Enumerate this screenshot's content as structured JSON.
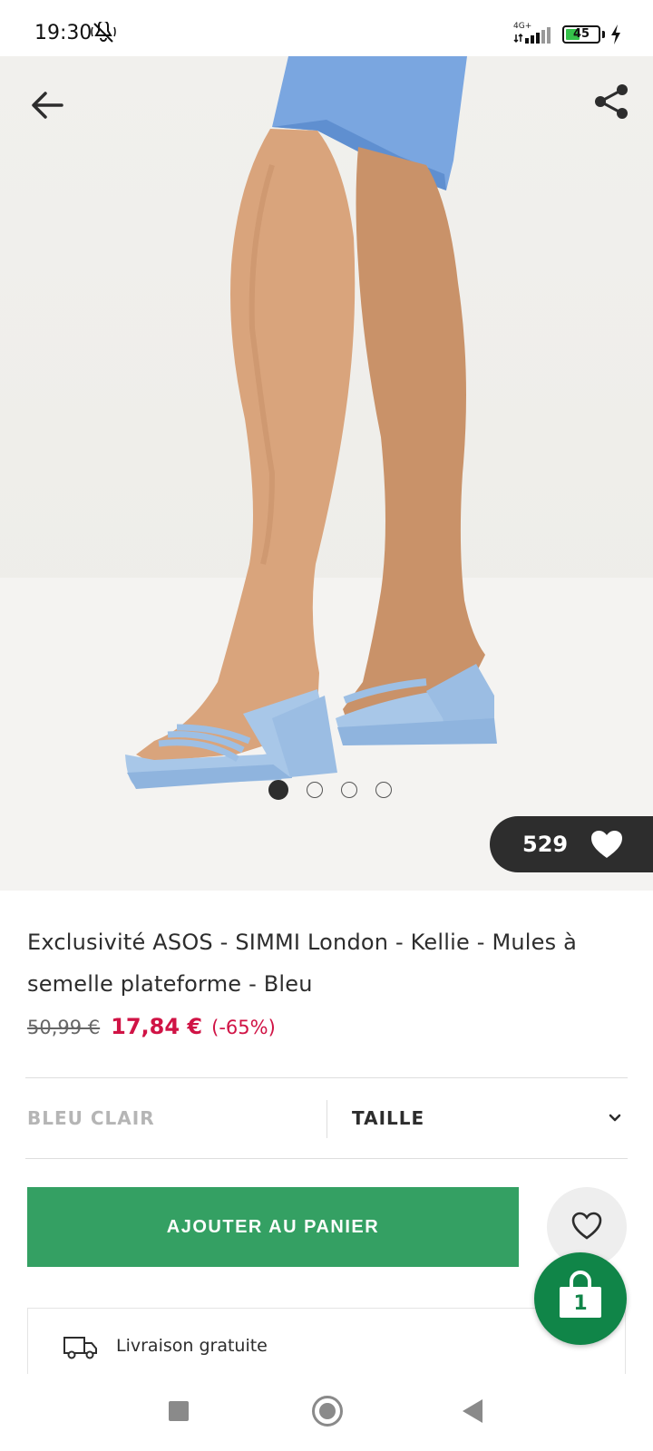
{
  "status_bar": {
    "time": "19:30",
    "network": "4G+",
    "battery": "45",
    "battery_level": 0.45
  },
  "icons": {
    "back": "arrow-left-icon",
    "share": "share-icon",
    "like": "heart-filled-icon",
    "save": "heart-outline-icon",
    "size_dropdown": "chevron-down-icon",
    "delivery": "truck-icon",
    "bag": "shopping-bag-icon"
  },
  "gallery": {
    "image_count": 4,
    "active_index": 0,
    "like_count": "529"
  },
  "product": {
    "title": "Exclusivité ASOS - SIMMI London - Kellie - Mules à semelle plateforme - Bleu",
    "old_price": "50,99 €",
    "new_price": "17,84 €",
    "discount": "(-65%)"
  },
  "options": {
    "color": "BLEU CLAIR",
    "size": "TAILLE"
  },
  "actions": {
    "add_to_cart": "AJOUTER AU PANIER"
  },
  "bag": {
    "count": "1"
  },
  "delivery": {
    "text": "Livraison gratuite"
  },
  "colors": {
    "cta_green": "#34a063",
    "bag_green": "#108548",
    "sale_red": "#d01345",
    "dark": "#2d2d2d"
  }
}
